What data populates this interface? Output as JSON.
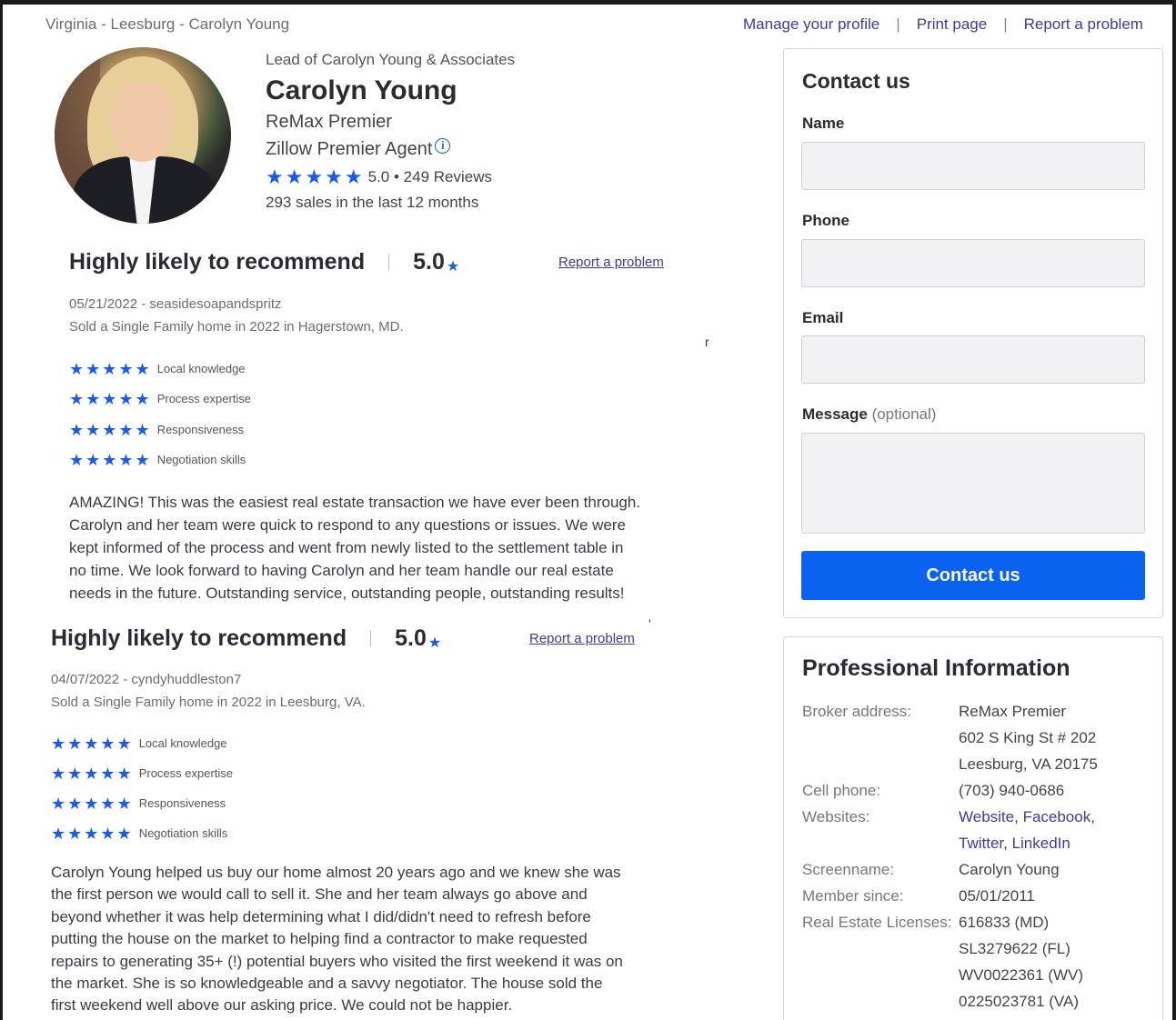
{
  "breadcrumb": "Virginia - Leesburg - Carolyn Young",
  "toplinks": {
    "manage": "Manage your profile",
    "sep1": "|",
    "print": "Print page",
    "sep2": "|",
    "report": "Report a problem"
  },
  "profile": {
    "lead": "Lead of Carolyn Young & Associates",
    "name": "Carolyn Young",
    "brokerage": "ReMax Premier",
    "premier": "Zillow Premier Agent",
    "info_icon": "i",
    "stars": "★★★★★",
    "rating": "5.0 • 249 Reviews",
    "sales": "293 sales in the last 12 months"
  },
  "reviews": [
    {
      "headline": "Highly likely to recommend",
      "score": "5.0",
      "report": "Report a problem",
      "date_user": "05/21/2022 - seasidesoapandspritz",
      "sold": "Sold a Single Family home in 2022 in Hagerstown, MD.",
      "subratings": [
        {
          "stars": "★★★★★",
          "label": "Local knowledge"
        },
        {
          "stars": "★★★★★",
          "label": "Process expertise"
        },
        {
          "stars": "★★★★★",
          "label": "Responsiveness"
        },
        {
          "stars": "★★★★★",
          "label": "Negotiation skills"
        }
      ],
      "body_lines": [
        "AMAZING!  This was the easiest real estate transaction we have ever been through.",
        "Carolyn and her team were quick to respond to any questions or issues.  We were",
        "kept informed of the process and went from newly listed to the settlement table in",
        "no time.  We look forward to having Carolyn and her team handle our real estate",
        "needs in the future.  Outstanding service, outstanding people, outstanding results!"
      ]
    },
    {
      "headline": "Highly likely to recommend",
      "score": "5.0",
      "report": "Report a problem",
      "date_user": "04/07/2022 - cyndyhuddleston7",
      "sold": "Sold a Single Family home in 2022 in Leesburg, VA.",
      "subratings": [
        {
          "stars": "★★★★★",
          "label": "Local knowledge"
        },
        {
          "stars": "★★★★★",
          "label": "Process expertise"
        },
        {
          "stars": "★★★★★",
          "label": "Responsiveness"
        },
        {
          "stars": "★★★★★",
          "label": "Negotiation skills"
        }
      ],
      "body_lines": [
        "Carolyn Young helped us buy our home almost 20 years ago and we knew she was",
        "the first person we would call to sell it. She and her team always go above and",
        "beyond whether it was help determining  what I did/didn't need to refresh before",
        "putting the house on the market to helping find a contractor to make requested",
        "repairs to generating 35+ (!) potential buyers who visited the first weekend it was on",
        "the market. She is so knowledgeable and a savvy negotiator.  The house sold the",
        "first weekend well above our asking price. We could not be happier."
      ]
    }
  ],
  "contact": {
    "title": "Contact us",
    "name_label": "Name",
    "phone_label": "Phone",
    "email_label": "Email",
    "message_label": "Message",
    "message_optional": "(optional)",
    "name_value": "",
    "phone_value": "",
    "email_value": "",
    "message_value": "",
    "button": "Contact us"
  },
  "professional": {
    "title": "Professional Information",
    "broker_label": "Broker address:",
    "broker_lines": [
      "ReMax Premier",
      "602 S King St # 202",
      "Leesburg, VA 20175"
    ],
    "cell_label": "Cell phone:",
    "cell": "(703) 940-0686",
    "websites_label": "Websites:",
    "websites": [
      "Website",
      "Facebook",
      "Twitter",
      "LinkedIn"
    ],
    "screenname_label": "Screenname:",
    "screenname": "Carolyn Young",
    "member_label": "Member since:",
    "member": "05/01/2011",
    "licenses_label": "Real Estate Licenses:",
    "licenses": [
      "616833 (MD)",
      "SL3279622 (FL)",
      "WV0022361 (WV)",
      "0225023781 (VA)"
    ]
  },
  "colors": {
    "accent": "#0a62f0",
    "star": "#1a5ce8",
    "link": "#3b3b9a"
  }
}
